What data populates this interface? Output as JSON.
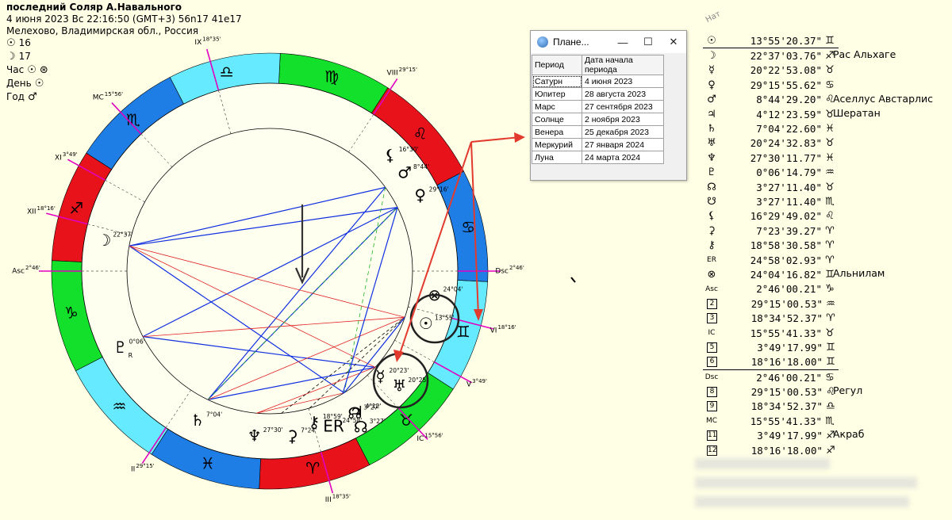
{
  "header": {
    "title": "последний Соляр А.Навального",
    "datetime": "4 июня 2023  Вс  22:16:50 (GMT+3) 56n17  41e17",
    "place": "Мелехово, Владимирская обл., Россия"
  },
  "legend": {
    "sun_value": "16",
    "moon_value": "17",
    "hour_label": "Час",
    "day_label": "День",
    "year_label": "Год"
  },
  "window": {
    "title": "Плане...",
    "minimize": "—",
    "maximize": "☐",
    "close": "✕",
    "columns": [
      "Период",
      "Дата начала периода"
    ],
    "rows": [
      [
        "Сатурн",
        "4 июня 2023"
      ],
      [
        "Юпитер",
        "28 августа 2023"
      ],
      [
        "Марс",
        "27 сентября 2023"
      ],
      [
        "Солнце",
        "2 ноября 2023"
      ],
      [
        "Венера",
        "25 декабря 2023"
      ],
      [
        "Меркурий",
        "27 января 2024"
      ],
      [
        "Луна",
        "24 марта 2024"
      ]
    ]
  },
  "nat_label": "Нат",
  "positions": [
    {
      "glyph": "☉",
      "pos": "13°55'20.37\"",
      "sign": "♊"
    },
    {
      "glyph": "☽",
      "pos": "22°37'03.76\"",
      "sign": "♐"
    },
    {
      "glyph": "☿",
      "pos": "20°22'53.08\"",
      "sign": "♉"
    },
    {
      "glyph": "♀",
      "pos": "29°15'55.62\"",
      "sign": "♋"
    },
    {
      "glyph": "♂",
      "pos": "8°44'29.20\"",
      "sign": "♌"
    },
    {
      "glyph": "♃",
      "pos": "4°12'23.59\"",
      "sign": "♉"
    },
    {
      "glyph": "♄",
      "pos": "7°04'22.60\"",
      "sign": "♓"
    },
    {
      "glyph": "♅",
      "pos": "20°24'32.83\"",
      "sign": "♉"
    },
    {
      "glyph": "♆",
      "pos": "27°30'11.77\"",
      "sign": "♓"
    },
    {
      "glyph": "♇",
      "pos": "0°06'14.79\"",
      "sign": "♒"
    },
    {
      "glyph": "☊",
      "pos": "3°27'11.40\"",
      "sign": "♉"
    },
    {
      "glyph": "☋",
      "pos": "3°27'11.40\"",
      "sign": "♏"
    },
    {
      "glyph": "⚸",
      "pos": "16°29'49.02\"",
      "sign": "♌"
    },
    {
      "glyph": "⚳",
      "pos": "7°23'39.27\"",
      "sign": "♈"
    },
    {
      "glyph": "⚷",
      "pos": "18°58'30.58\"",
      "sign": "♈"
    },
    {
      "glyph": "ER",
      "pos": "24°58'02.93\"",
      "sign": "♈"
    },
    {
      "glyph": "⊗",
      "pos": "24°04'16.82\"",
      "sign": "♊"
    },
    {
      "glyph": "Asc",
      "pos": "2°46'00.21\"",
      "sign": "♑"
    },
    {
      "glyph": "2",
      "pos": "29°15'00.53\"",
      "sign": "♒"
    },
    {
      "glyph": "3",
      "pos": "18°34'52.37\"",
      "sign": "♈"
    },
    {
      "glyph": "IC",
      "pos": "15°55'41.33\"",
      "sign": "♉"
    },
    {
      "glyph": "5",
      "pos": "3°49'17.99\"",
      "sign": "♊"
    },
    {
      "glyph": "6",
      "pos": "18°16'18.00\"",
      "sign": "♊"
    },
    {
      "glyph": "Dsc",
      "pos": "2°46'00.21\"",
      "sign": "♋"
    },
    {
      "glyph": "8",
      "pos": "29°15'00.53\"",
      "sign": "♌"
    },
    {
      "glyph": "9",
      "pos": "18°34'52.37\"",
      "sign": "♎"
    },
    {
      "glyph": "MC",
      "pos": "15°55'41.33\"",
      "sign": "♏"
    },
    {
      "glyph": "11",
      "pos": "3°49'17.99\"",
      "sign": "♐"
    },
    {
      "glyph": "12",
      "pos": "18°16'18.00\"",
      "sign": "♐"
    }
  ],
  "stars": [
    {
      "row": 1,
      "name": "Рас Альхаге"
    },
    {
      "row": 4,
      "name": "Аселлус Австарлис"
    },
    {
      "row": 5,
      "name": "Шератан"
    },
    {
      "row": 16,
      "name": "Альнилам"
    },
    {
      "row": 24,
      "name": "Регул"
    },
    {
      "row": 27,
      "name": "Акраб"
    }
  ],
  "wheel": {
    "signs": [
      "♈",
      "♉",
      "♊",
      "♋",
      "♌",
      "♍",
      "♎",
      "♏",
      "♐",
      "♑",
      "♒",
      "♓"
    ],
    "sign_colors": [
      "#e8121b",
      "#12e02a",
      "#66eaff",
      "#1f7de6",
      "#e8121b",
      "#12e02a",
      "#66eaff",
      "#1f7de6",
      "#e8121b",
      "#12e02a",
      "#66eaff",
      "#1f7de6"
    ],
    "cusps": [
      {
        "label": "Asc",
        "deg": "2°46'"
      },
      {
        "label": "II",
        "deg": "29°15'"
      },
      {
        "label": "III",
        "deg": "18°35'"
      },
      {
        "label": "IC",
        "deg": "15°56'"
      },
      {
        "label": "V",
        "deg": "3°49'"
      },
      {
        "label": "VI",
        "deg": "18°16'"
      },
      {
        "label": "Dsc",
        "deg": "2°46'"
      },
      {
        "label": "VIII",
        "deg": "29°15'"
      },
      {
        "label": "IX",
        "deg": "18°35'"
      },
      {
        "label": "MC",
        "deg": "15°56'"
      },
      {
        "label": "XI",
        "deg": "3°49'"
      },
      {
        "label": "XII",
        "deg": "18°16'"
      }
    ],
    "planets": [
      {
        "glyph": "☊",
        "deg": "3°27'"
      },
      {
        "glyph": "⚸",
        "deg": "16°30'"
      },
      {
        "glyph": "♂",
        "deg": "8°44'"
      },
      {
        "glyph": "♀",
        "deg": "29°16'"
      },
      {
        "glyph": "☽",
        "deg": "22°37'"
      },
      {
        "glyph": "⊗",
        "deg": "24°04'"
      },
      {
        "glyph": "☉",
        "deg": "13°55'"
      },
      {
        "glyph": "♇",
        "deg": "0°06'"
      },
      {
        "glyph": "☿",
        "deg": "20°23'"
      },
      {
        "glyph": "♅",
        "deg": "20°25'"
      },
      {
        "glyph": "♃",
        "deg": "4°12'"
      },
      {
        "glyph": "♄",
        "deg": "7°04'"
      },
      {
        "glyph": "♆",
        "deg": "27°30'"
      },
      {
        "glyph": "⚳",
        "deg": "7°24'"
      },
      {
        "glyph": "⚷",
        "deg": "18°59'"
      },
      {
        "glyph": "☊",
        "deg": "3°27'"
      },
      {
        "glyph": "ER",
        "deg": "24°58'"
      },
      {
        "glyph": "☋",
        "deg": ""
      }
    ],
    "retro": "R"
  }
}
